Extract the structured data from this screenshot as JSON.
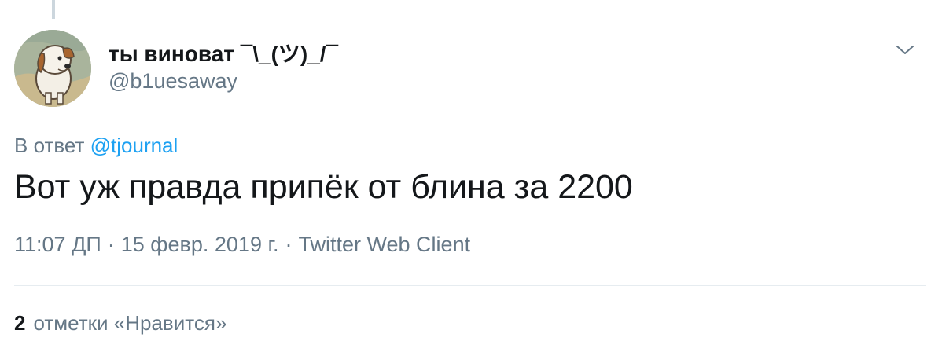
{
  "tweet": {
    "author": {
      "display_name": "ты виноват ¯\\_(ツ)_/¯",
      "handle": "@b1uesaway",
      "avatar_icon": "dog-avatar-icon"
    },
    "reply": {
      "prefix": "В ответ",
      "mention": "@tjournal"
    },
    "text": "Вот уж правда припёк от блина за 2200",
    "meta": {
      "time": "11:07 ДП",
      "separator": "·",
      "date": "15 февр. 2019 г.",
      "client": "Twitter Web Client"
    },
    "stats": {
      "likes_count": "2",
      "likes_label": "отметки «Нравится»"
    }
  },
  "colors": {
    "text_primary": "#14171a",
    "text_secondary": "#657786",
    "link": "#1da1f2",
    "divider": "#e6ecf0",
    "thread_line": "#ccd6dd"
  },
  "icons": {
    "menu": "chevron-down-icon"
  }
}
